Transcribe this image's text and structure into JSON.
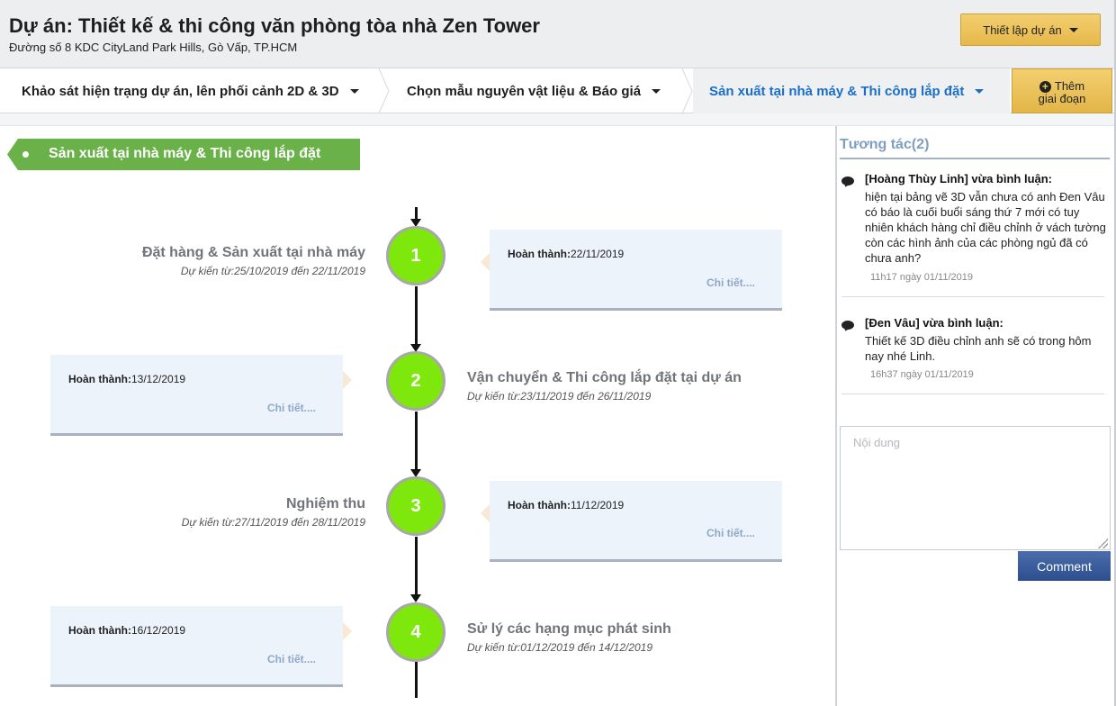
{
  "header": {
    "title": "Dự án: Thiết kế & thi công văn phòng tòa nhà Zen Tower",
    "address": "Đường số 8 KDC CityLand Park Hills, Gò Vấp, TP.HCM",
    "setup_button": "Thiết lập dự án"
  },
  "tabs": [
    {
      "label": "Khảo sát hiện trạng dự án, lên phối cảnh 2D & 3D",
      "active": false
    },
    {
      "label": "Chọn mẫu nguyên vật liệu & Báo giá",
      "active": false
    },
    {
      "label": "Sản xuất tại nhà máy & Thi công lắp đặt",
      "active": true
    }
  ],
  "add_stage": {
    "line1": "Thêm",
    "line2": "giai đoạn"
  },
  "section": {
    "title": "Sản xuất tại nhà máy & Thi công lắp đặt"
  },
  "stages": [
    {
      "number": "1",
      "title": "Đặt hàng & Sản xuất tại nhà máy",
      "planned": "Dự kiến từ:25/10/2019 đến 22/11/2019",
      "done_label": "Hoàn thành:",
      "done_date": "22/11/2019",
      "detail": "Chi tiết...."
    },
    {
      "number": "2",
      "title": "Vận chuyển & Thi công lắp đặt tại dự án",
      "planned": "Dự kiến từ:23/11/2019 đến 26/11/2019",
      "done_label": "Hoàn thành:",
      "done_date": "13/12/2019",
      "detail": "Chi tiết...."
    },
    {
      "number": "3",
      "title": "Nghiệm thu",
      "planned": "Dự kiến từ:27/11/2019 đến 28/11/2019",
      "done_label": "Hoàn thành:",
      "done_date": "11/12/2019",
      "detail": "Chi tiết...."
    },
    {
      "number": "4",
      "title": "Sử lý các hạng mục phát sinh",
      "planned": "Dự kiến từ:01/12/2019 đến 14/12/2019",
      "done_label": "Hoàn thành:",
      "done_date": "16/12/2019",
      "detail": "Chi tiết...."
    }
  ],
  "sidebar": {
    "title": "Tương tác(2)",
    "comments": [
      {
        "author": "[Hoàng Thùy Linh] vừa bình luận:",
        "text": "hiện tại bảng vẽ 3D vẫn chưa có anh Đen Vâu có báo là cuối buổi sáng thứ 7 mới có tuy nhiên khách hàng chỉ điều chỉnh ở vách tường còn các hình ảnh của các phòng ngủ đã có chưa anh?",
        "time": "11h17 ngày 01/11/2019"
      },
      {
        "author": "[Đen Vâu] vừa bình luận:",
        "text": "Thiết kế 3D điều chỉnh anh sẽ có trong hôm nay nhé Linh.",
        "time": "16h37 ngày 01/11/2019"
      }
    ],
    "input_placeholder": "Nội dung",
    "comment_button": "Comment"
  }
}
